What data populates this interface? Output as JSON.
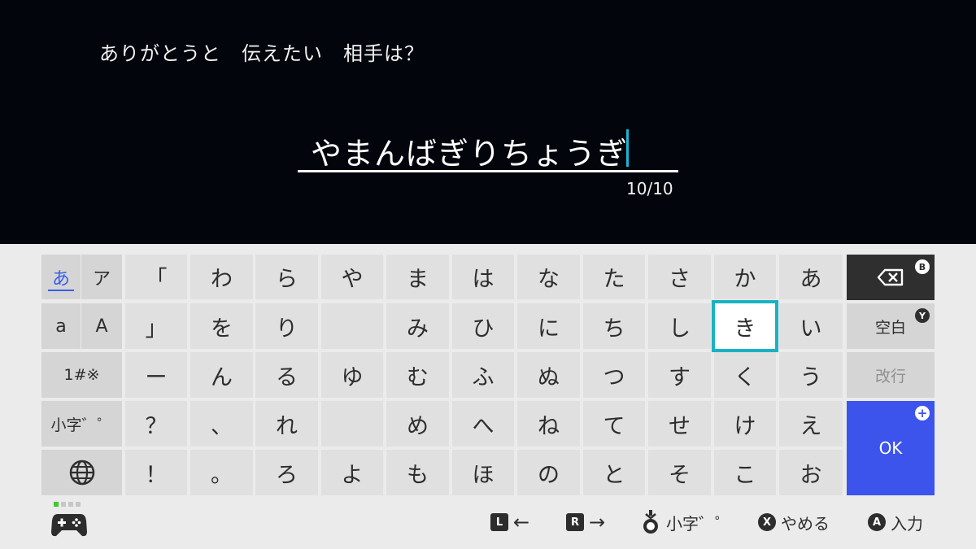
{
  "prompt": "ありがとうと　伝えたい　相手は？",
  "input": {
    "value": "やまんばぎりちょうぎ",
    "counter": "10/10"
  },
  "modes": {
    "hiragana": "あ",
    "katakana": "ア",
    "lower": "a",
    "upper": "A",
    "symbols": "1#※",
    "small": "小字゛゜",
    "globe": "globe-icon"
  },
  "grid": {
    "cols": [
      [
        "「",
        "」",
        "ー",
        "？",
        "！"
      ],
      [
        "わ",
        "を",
        "ん",
        "、",
        "。"
      ],
      [
        "ら",
        "り",
        "る",
        "れ",
        "ろ"
      ],
      [
        "や",
        "",
        "ゆ",
        "",
        "よ"
      ],
      [
        "ま",
        "み",
        "む",
        "め",
        "も"
      ],
      [
        "は",
        "ひ",
        "ふ",
        "へ",
        "ほ"
      ],
      [
        "な",
        "に",
        "ぬ",
        "ね",
        "の"
      ],
      [
        "た",
        "ち",
        "つ",
        "て",
        "と"
      ],
      [
        "さ",
        "し",
        "す",
        "せ",
        "そ"
      ],
      [
        "か",
        "き",
        "く",
        "け",
        "こ"
      ],
      [
        "あ",
        "い",
        "う",
        "え",
        "お"
      ]
    ],
    "selected": "き"
  },
  "actions": {
    "backspace_badge": "B",
    "space": "空白",
    "space_badge": "Y",
    "newline": "改行",
    "ok": "OK",
    "ok_badge": "+"
  },
  "hints": {
    "l_button": "L",
    "r_button": "R",
    "small_label": "小字゛゜",
    "x_button": "X",
    "cancel": "やめる",
    "a_button": "A",
    "input": "入力"
  },
  "colors": {
    "accent_blue": "#3c54ec",
    "selection_teal": "#1ab2c3",
    "caret": "#19b6d6",
    "player_indicator": "#45c52d"
  }
}
